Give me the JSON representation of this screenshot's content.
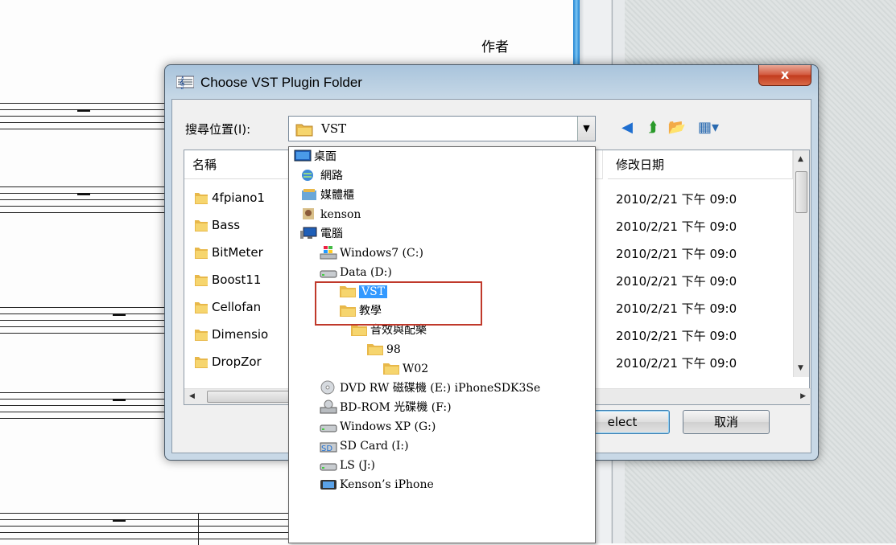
{
  "background": {
    "author_label": "作者"
  },
  "dialog": {
    "title": "Choose VST Plugin Folder",
    "close_label": "x",
    "look_in_label": "搜尋位置(I):",
    "look_in_value": "VST",
    "columns": {
      "name": "名稱",
      "date": "修改日期"
    },
    "files": [
      {
        "name": "4fpiano1",
        "date": "2010/2/21 下午 09:0"
      },
      {
        "name": "Bass",
        "date": "2010/2/21 下午 09:0"
      },
      {
        "name": "BitMeter",
        "date": "2010/2/21 下午 09:0"
      },
      {
        "name": "Boost11",
        "date": "2010/2/21 下午 09:0"
      },
      {
        "name": "Cellofan",
        "date": "2010/2/21 下午 09:0"
      },
      {
        "name": "Dimensio",
        "date": "2010/2/21 下午 09:0"
      },
      {
        "name": "DropZor",
        "date": "2010/2/21 下午 09:0"
      }
    ],
    "select_label": "elect",
    "cancel_label": "取消"
  },
  "dropdown": {
    "items": [
      {
        "label": "桌面",
        "icon": "desktop-icon"
      },
      {
        "label": "網路",
        "icon": "network-icon"
      },
      {
        "label": "媒體櫃",
        "icon": "libraries-icon"
      },
      {
        "label": "kenson",
        "icon": "user-icon"
      },
      {
        "label": "電腦",
        "icon": "computer-icon"
      },
      {
        "label": "Windows7 (C:)",
        "icon": "windows-drive-icon"
      },
      {
        "label": "Data (D:)",
        "icon": "hard-drive-icon"
      },
      {
        "label": "VST",
        "icon": "folder-icon"
      },
      {
        "label": "教學",
        "icon": "folder-icon"
      },
      {
        "label": "音效與配樂",
        "icon": "folder-icon"
      },
      {
        "label": "98",
        "icon": "folder-icon"
      },
      {
        "label": "W02",
        "icon": "folder-icon"
      },
      {
        "label": "DVD RW 磁碟機 (E:) iPhoneSDK3Se",
        "icon": "dvd-drive-icon"
      },
      {
        "label": "BD-ROM 光碟機 (F:)",
        "icon": "bd-drive-icon"
      },
      {
        "label": "Windows XP (G:)",
        "icon": "hard-drive-icon"
      },
      {
        "label": "SD Card (I:)",
        "icon": "sd-card-icon"
      },
      {
        "label": "LS (J:)",
        "icon": "hard-drive-icon"
      },
      {
        "label": "Kenson’s iPhone",
        "icon": "phone-icon"
      }
    ]
  }
}
